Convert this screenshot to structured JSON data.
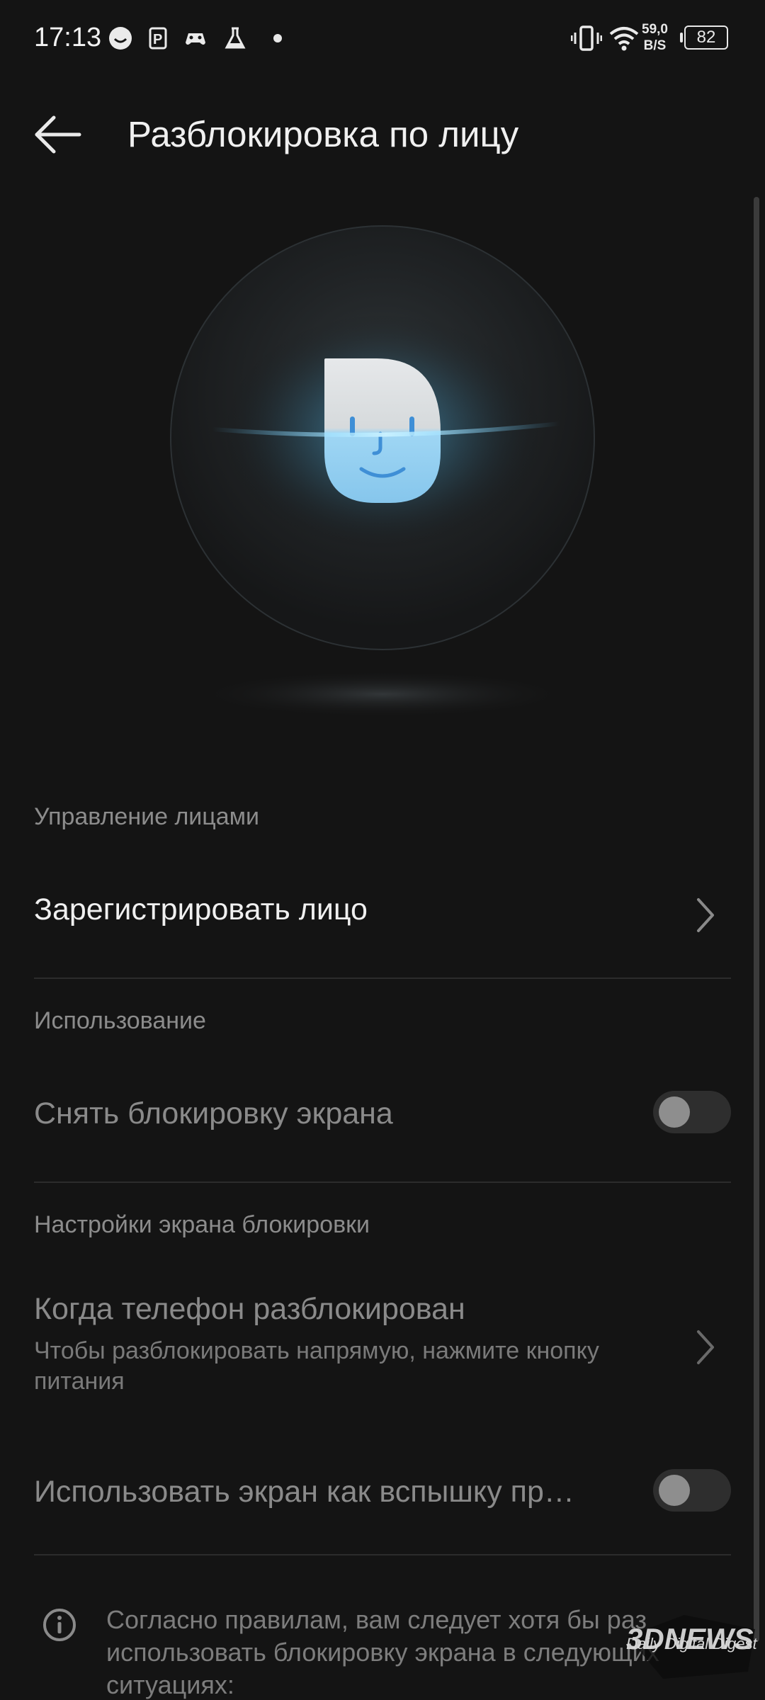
{
  "status_bar": {
    "time": "17:13",
    "network_speed_value": "59,0",
    "network_speed_unit": "B/S",
    "battery": "82",
    "icons": [
      "chat-bubble-icon",
      "parking-app-icon",
      "gamepad-icon",
      "flask-icon",
      "notification-dot",
      "vibrate-icon",
      "wifi-icon",
      "battery-icon"
    ]
  },
  "header": {
    "title": "Разблокировка по лицу",
    "back_icon": "arrow-left-icon"
  },
  "sections": {
    "face_management": {
      "header": "Управление лицами",
      "register_label": "Зарегистрировать лицо"
    },
    "usage": {
      "header": "Использование",
      "unlock_label": "Снять блокировку экрана",
      "unlock_enabled": false
    },
    "lock_screen": {
      "header": "Настройки экрана блокировки",
      "when_unlocked_label": "Когда телефон разблокирован",
      "when_unlocked_sub": "Чтобы разблокировать напрямую, нажмите кнопку питания",
      "flash_label": "Использовать экран как вспышку пр…",
      "flash_enabled": false
    }
  },
  "info": {
    "text": "Согласно правилам, вам следует хотя бы раз использовать блокировку экрана в следующих ситуациях:"
  },
  "watermark": {
    "brand": "3DNEWS",
    "tagline": "Daily Digital Digest"
  },
  "colors": {
    "background": "#141414",
    "text_primary": "#f0f0f0",
    "text_secondary": "#8c8c8c",
    "accent_glow": "#5cc8ff"
  }
}
